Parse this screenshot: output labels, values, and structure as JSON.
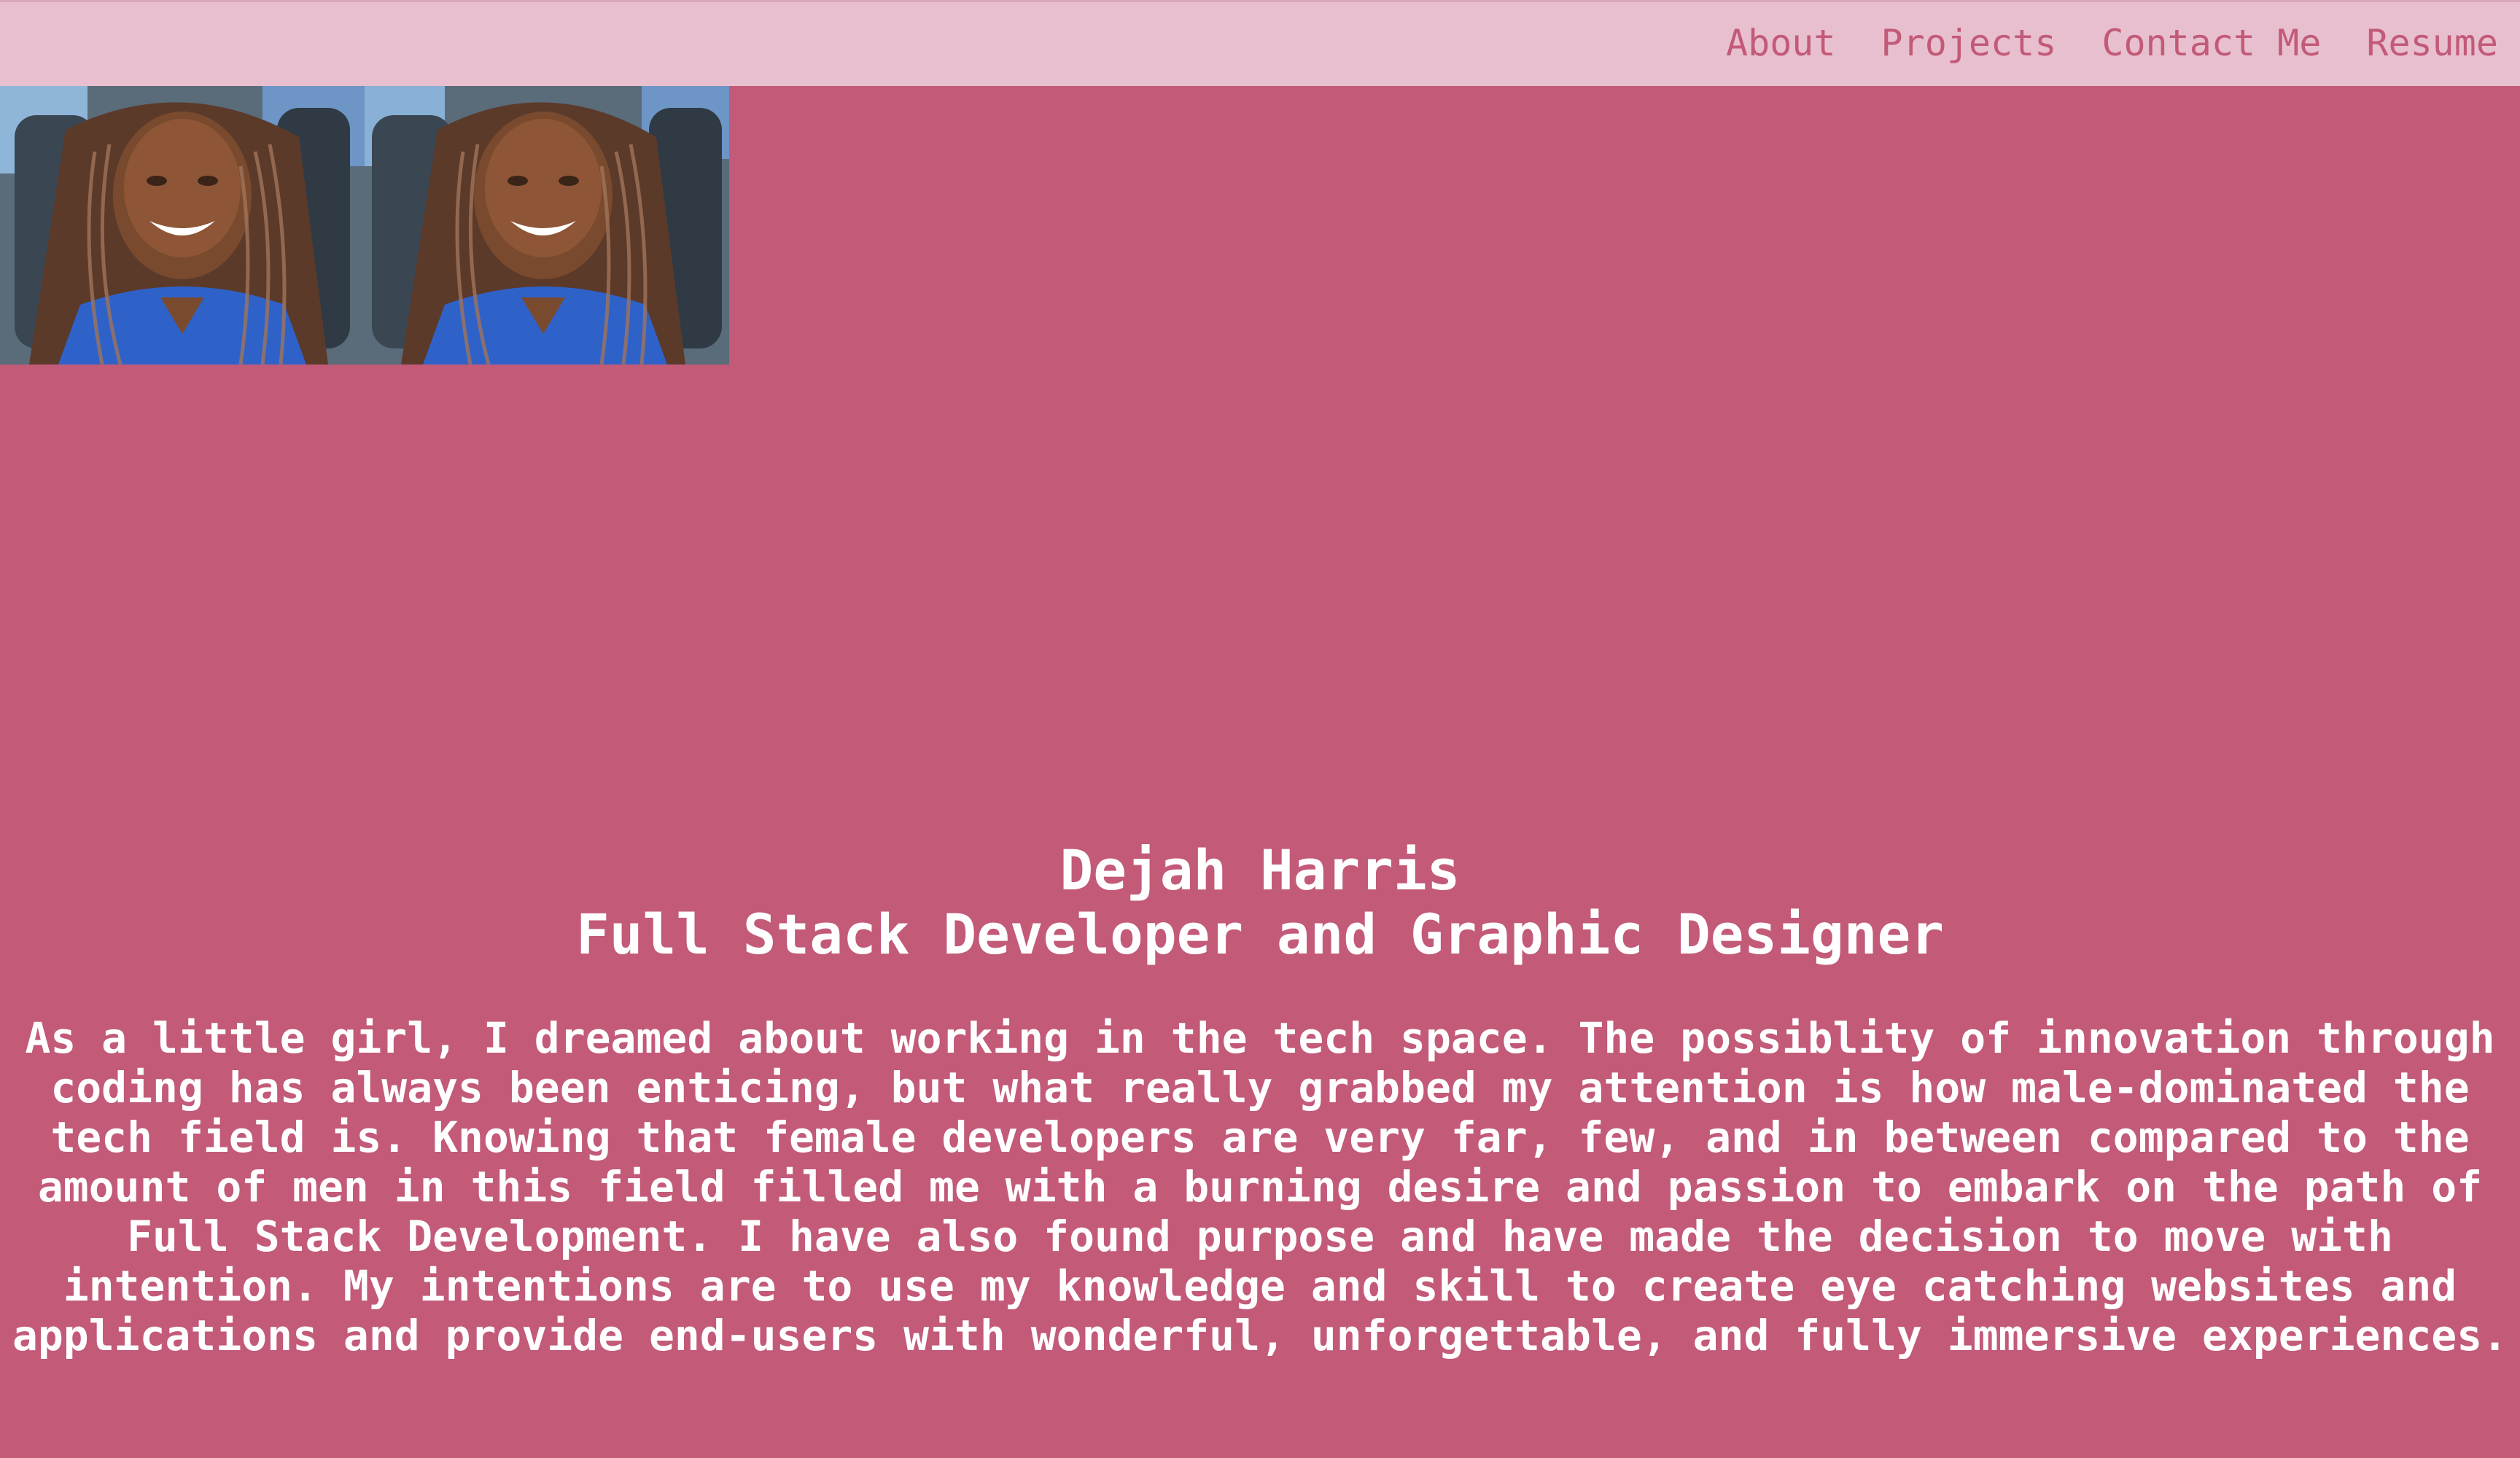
{
  "nav": {
    "items": [
      {
        "label": "About"
      },
      {
        "label": "Projects"
      },
      {
        "label": "Contact Me"
      },
      {
        "label": "Resume"
      }
    ]
  },
  "hero": {
    "name": "Dejah Harris",
    "role": "Full Stack Developer and Graphic Designer",
    "bio": "As a little girl, I dreamed about working in the tech space. The possiblity of innovation through coding has always been enticing, but what really grabbed my attention is how male-dominated the tech field is. Knowing that female developers are very far, few, and in between compared to the amount of men in this field filled me with a burning desire and passion to embark on the path of Full Stack Development. I have also found purpose and have made the decision to move with intention. My intentions are to use my knowledge and skill to create eye catching websites and applications and provide end-users with wonderful, unforgettable, and fully immersive experiences."
  },
  "colors": {
    "background": "#c25a78",
    "navbar": "#e8bfce",
    "nav_text": "#c25a78",
    "hero_text": "#ffffff"
  },
  "photos": [
    {
      "icon": "profile-photo"
    },
    {
      "icon": "profile-photo"
    }
  ]
}
